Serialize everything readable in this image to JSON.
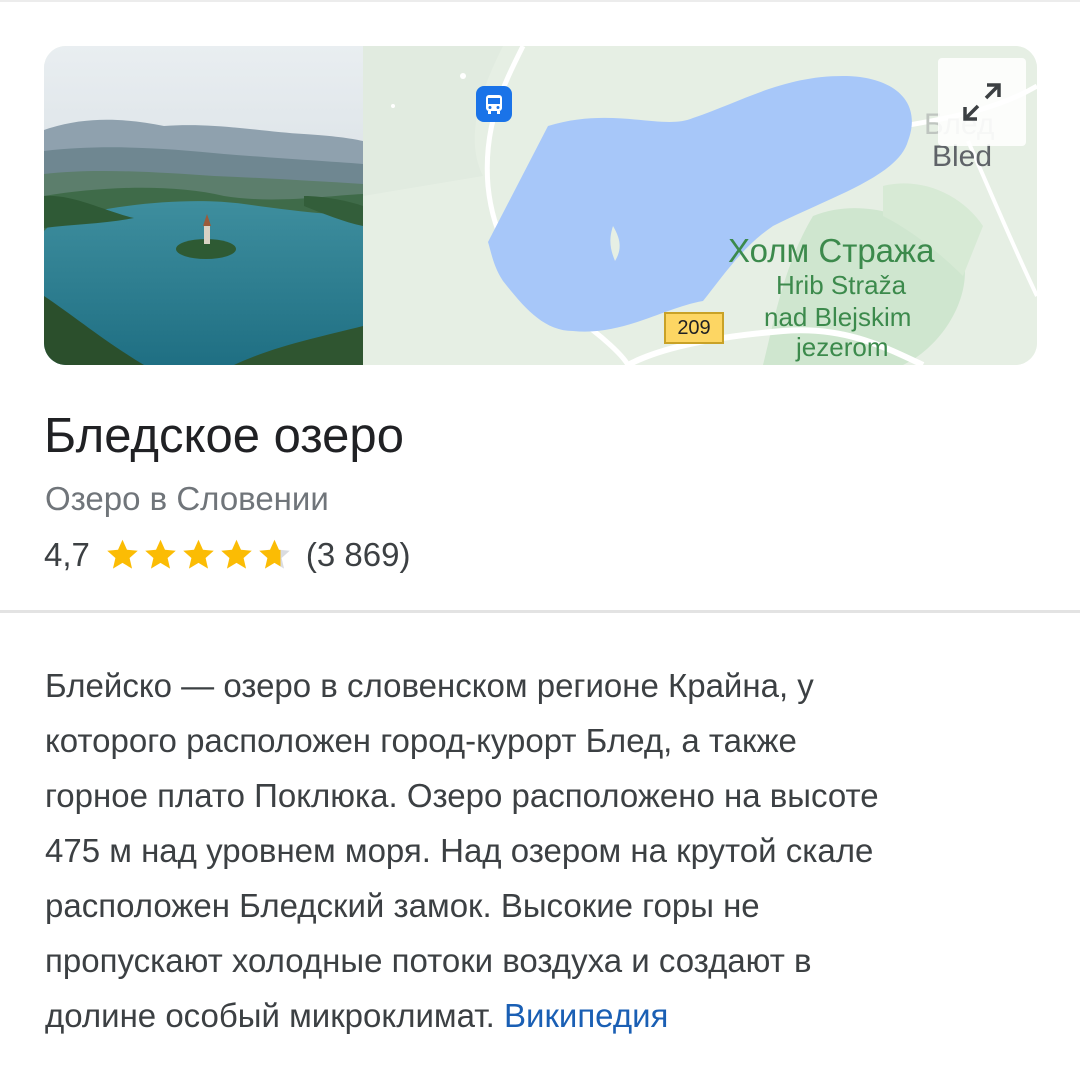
{
  "place": {
    "title": "Бледское озеро",
    "subtitle": "Озеро в Словении",
    "rating": "4,7",
    "rating_stars": 4.7,
    "reviews": "(3 869)"
  },
  "map": {
    "label_bled_ghost": "Блед",
    "label_bled": "Bled",
    "label_hill_ru": "Холм Стража",
    "label_hill_sl_1": "Hrib Straža",
    "label_hill_sl_2": "nad Blejskim",
    "label_hill_sl_3": "jezerom",
    "road_number": "209",
    "icons": [
      "bus-stop-icon",
      "expand-icon"
    ]
  },
  "description": {
    "lines": [
      "Блейско — озеро в словенском регионе Крайна, у",
      "которого расположен город-курорт Блед, а также",
      "горное плато Поклюка. Озеро расположено на высоте",
      "475 м над уровнем моря. Над озером на крутой скале",
      "расположен Бледский замок. Высокие горы не",
      "пропускают холодные потоки воздуха и создают в"
    ],
    "last_line": "долине особый микроклимат.",
    "source_link": "Википедия"
  },
  "colors": {
    "star": "#fbbc04",
    "star_empty": "#dadce0",
    "link": "#1a5fb4",
    "lake": "#a7c7f9",
    "map_bg": "#e6efe4",
    "label_green": "#3c8a4c"
  }
}
